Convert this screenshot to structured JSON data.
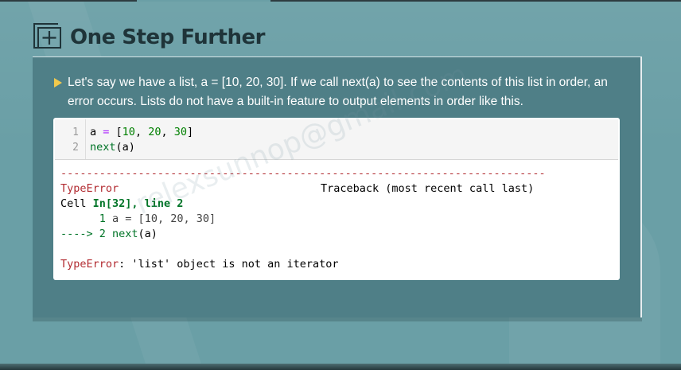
{
  "title": {
    "text": "One Step Further",
    "icon": "plus-box-icon"
  },
  "content": {
    "bullet_text": "Let's say we have a list, a = [10, 20, 30]. If we call next(a) to see the contents of this list in order, an error occurs. Lists do not have a built-in feature to output elements in order like this."
  },
  "code_cell": {
    "line_numbers": [
      "1",
      "2"
    ],
    "lines": [
      {
        "var": "a",
        "op": " = ",
        "open": "[",
        "n1": "10",
        "sep1": ", ",
        "n2": "20",
        "sep2": ", ",
        "n3": "30",
        "close": "]"
      },
      {
        "fn": "next",
        "args": "(a)"
      }
    ]
  },
  "output": {
    "dashes": "---------------------------------------------------------------------------",
    "error_type": "TypeError",
    "traceback_label": "Traceback (most recent call last)",
    "cell_label": "Cell ",
    "cell_ref": "In[32], line 2",
    "tb_line1_no": "1",
    "tb_line1_code": " a = [10, 20, 30]",
    "tb_arrow": "----> 2 ",
    "tb_line2_fn": "next",
    "tb_line2_args": "(a)",
    "final_error_type": "TypeError",
    "final_error_msg": ": 'list' object is not an iterator"
  },
  "watermark": "relexsunnop@gmail.com",
  "colors": {
    "background": "#6a9fa6",
    "panel": "#4f7f87",
    "title": "#1f3439",
    "error_red": "#b22b31",
    "keyword_green": "#007427"
  }
}
